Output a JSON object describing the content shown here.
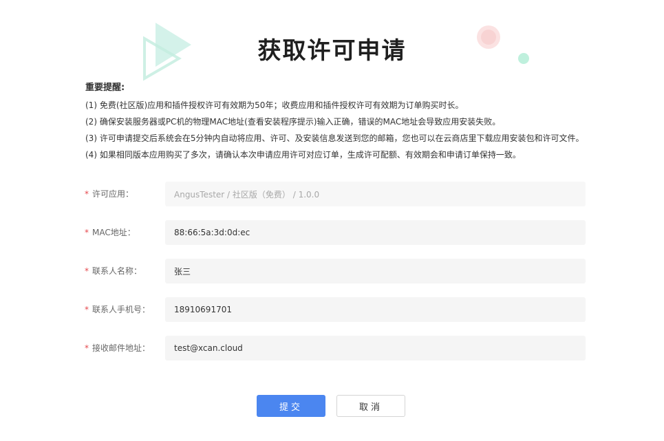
{
  "page": {
    "title": "获取许可申请"
  },
  "notes": {
    "heading": "重要提醒:",
    "items": [
      "(1) 免费(社区版)应用和插件授权许可有效期为50年；收费应用和插件授权许可有效期为订单购买时长。",
      "(2) 确保安装服务器或PC机的物理MAC地址(查看安装程序提示)输入正确，错误的MAC地址会导致应用安装失败。",
      "(3) 许可申请提交后系统会在5分钟内自动将应用、许可、及安装信息发送到您的邮箱，您也可以在云商店里下载应用安装包和许可文件。",
      "(4) 如果相同版本应用购买了多次，请确认本次申请应用许可对应订单，生成许可配额、有效期会和申请订单保持一致。"
    ]
  },
  "form": {
    "required_mark": "*",
    "app": {
      "label": "许可应用：",
      "value": "AngusTester / 社区版（免费） / 1.0.0"
    },
    "mac": {
      "label": "MAC地址：",
      "value": "88:66:5a:3d:0d:ec"
    },
    "contact_name": {
      "label": "联系人名称：",
      "value": "张三"
    },
    "contact_phone": {
      "label": "联系人手机号：",
      "value": "18910691701"
    },
    "email": {
      "label": "接收邮件地址：",
      "value": "test@xcan.cloud"
    }
  },
  "actions": {
    "submit_label": "提交",
    "cancel_label": "取消"
  },
  "colors": {
    "primary": "#4b86f0",
    "required": "#e5484d",
    "decor_teal": "#9be3cf",
    "decor_pink": "#f6c9c9"
  }
}
